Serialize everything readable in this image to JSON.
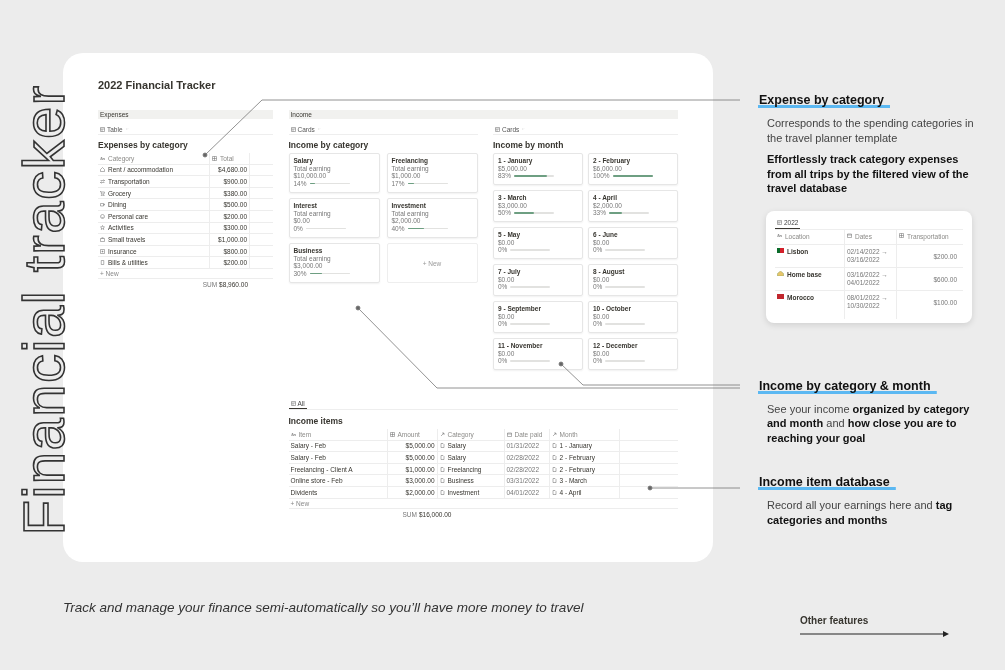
{
  "title_art": "Financial tracker",
  "page": {
    "title": "2022 Financial Tracker",
    "expenses": {
      "section": "Expenses",
      "view": "Table",
      "heading": "Expenses by category",
      "columns": [
        "Category",
        "Total"
      ],
      "rows": [
        {
          "category": "Rent / accommodation",
          "total": "$4,680.00"
        },
        {
          "category": "Transportation",
          "total": "$900.00"
        },
        {
          "category": "Grocery",
          "total": "$380.00"
        },
        {
          "category": "Dining",
          "total": "$500.00"
        },
        {
          "category": "Personal care",
          "total": "$200.00"
        },
        {
          "category": "Activities",
          "total": "$300.00"
        },
        {
          "category": "Small travels",
          "total": "$1,000.00"
        },
        {
          "category": "Insurance",
          "total": "$800.00"
        },
        {
          "category": "Bills & utilities",
          "total": "$200.00"
        }
      ],
      "new": "+ New",
      "sum_label": "SUM",
      "sum": "$8,960.00"
    },
    "income": {
      "section": "Income",
      "by_category": {
        "view": "Cards",
        "heading": "Income by category",
        "new": "+ New",
        "cards": [
          {
            "name": "Salary",
            "label": "Total earning",
            "amount": "$10,000.00",
            "percent": "14%",
            "level": 0.14
          },
          {
            "name": "Freelancing",
            "label": "Total earning",
            "amount": "$1,000.00",
            "percent": "17%",
            "level": 0.17
          },
          {
            "name": "Interest",
            "label": "Total earning",
            "amount": "$0.00",
            "percent": "0%",
            "level": 0
          },
          {
            "name": "Investment",
            "label": "Total earning",
            "amount": "$2,000.00",
            "percent": "40%",
            "level": 0.4
          },
          {
            "name": "Business",
            "label": "Total earning",
            "amount": "$3,000.00",
            "percent": "30%",
            "level": 0.3
          }
        ]
      },
      "by_month": {
        "view": "Cards",
        "heading": "Income by month",
        "cards": [
          {
            "name": "1 - January",
            "amount": "$5,000.00",
            "percent": "83%",
            "level": 0.83
          },
          {
            "name": "2 - February",
            "amount": "$6,000.00",
            "percent": "100%",
            "level": 1
          },
          {
            "name": "3 - March",
            "amount": "$3,000.00",
            "percent": "50%",
            "level": 0.5
          },
          {
            "name": "4 - April",
            "amount": "$2,000.00",
            "percent": "33%",
            "level": 0.33
          },
          {
            "name": "5 - May",
            "amount": "$0.00",
            "percent": "0%",
            "level": 0
          },
          {
            "name": "6 - June",
            "amount": "$0.00",
            "percent": "0%",
            "level": 0
          },
          {
            "name": "7 - July",
            "amount": "$0.00",
            "percent": "0%",
            "level": 0
          },
          {
            "name": "8 - August",
            "amount": "$0.00",
            "percent": "0%",
            "level": 0
          },
          {
            "name": "9 - September",
            "amount": "$0.00",
            "percent": "0%",
            "level": 0
          },
          {
            "name": "10 - October",
            "amount": "$0.00",
            "percent": "0%",
            "level": 0
          },
          {
            "name": "11 - November",
            "amount": "$0.00",
            "percent": "0%",
            "level": 0
          },
          {
            "name": "12 - December",
            "amount": "$0.00",
            "percent": "0%",
            "level": 0
          }
        ]
      }
    },
    "items": {
      "tab": "All",
      "heading": "Income items",
      "columns": [
        "Item",
        "Amount",
        "Category",
        "Date paid",
        "Month"
      ],
      "rows": [
        {
          "item": "Salary - Feb",
          "amount": "$5,000.00",
          "category": "Salary",
          "date": "01/31/2022",
          "month": "1 - January"
        },
        {
          "item": "Salary - Feb",
          "amount": "$5,000.00",
          "category": "Salary",
          "date": "02/28/2022",
          "month": "2 - February"
        },
        {
          "item": "Freelancing - Client A",
          "amount": "$1,000.00",
          "category": "Freelancing",
          "date": "02/28/2022",
          "month": "2 - February"
        },
        {
          "item": "Online store - Feb",
          "amount": "$3,000.00",
          "category": "Business",
          "date": "03/31/2022",
          "month": "3 - March"
        },
        {
          "item": "Dividents",
          "amount": "$2,000.00",
          "category": "Investment",
          "date": "04/01/2022",
          "month": "4 - April"
        }
      ],
      "new": "+ New",
      "sum_label": "SUM",
      "sum": "$16,000.00"
    }
  },
  "annotations": [
    {
      "heading": "Expense by category",
      "text": "Corresponds to the spending categories in the travel planner template",
      "note": "Effortlessly track category expenses from all trips by the filtered view of the travel database",
      "trips": {
        "tab": "2022",
        "columns": [
          "Location",
          "Dates",
          "Transportation"
        ],
        "rows": [
          {
            "location": "Lisbon",
            "dates": [
              "02/14/2022 →",
              "03/16/2022"
            ],
            "transportation": "$200.00"
          },
          {
            "location": "Home base",
            "dates": [
              "03/16/2022 →",
              "04/01/2022"
            ],
            "transportation": "$600.00"
          },
          {
            "location": "Morocco",
            "dates": [
              "08/01/2022 →",
              "10/30/2022"
            ],
            "transportation": "$100.00"
          }
        ]
      }
    },
    {
      "heading": "Income by category & month",
      "text": "See your income **organized by category and month** and **how close you are to reaching your goal**"
    },
    {
      "heading": "Income item database",
      "text": "Record all your earnings here and **tag categories and months**"
    }
  ],
  "caption": "Track and manage your finance semi-automatically so you’ll have more money to travel",
  "other_features": "Other features"
}
